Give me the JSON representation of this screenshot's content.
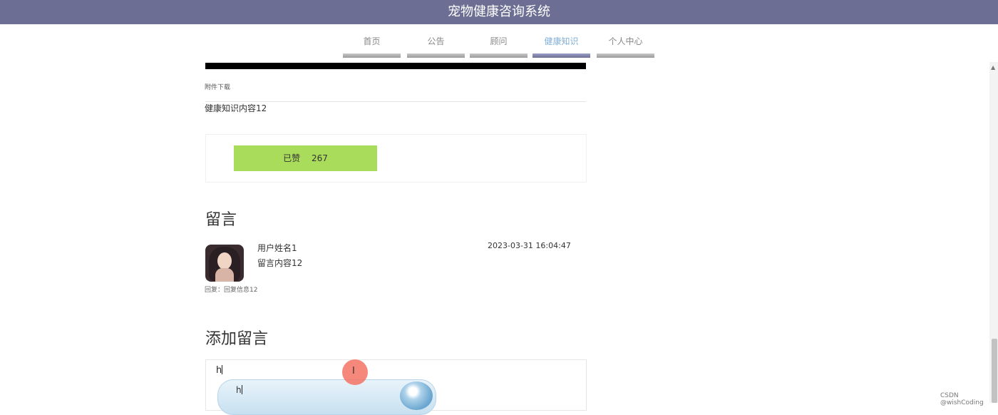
{
  "header": {
    "title": "宠物健康咨询系统"
  },
  "nav": {
    "items": [
      {
        "label": "首页"
      },
      {
        "label": "公告"
      },
      {
        "label": "顾问"
      },
      {
        "label": "健康知识"
      },
      {
        "label": "个人中心"
      }
    ],
    "active": "健康知识"
  },
  "article": {
    "attachment_label": "附件下载",
    "content": "健康知识内容12",
    "like": {
      "label": "已赞",
      "count": "267"
    }
  },
  "comments": {
    "heading": "留言",
    "items": [
      {
        "user": "用户姓名1",
        "content": "留言内容12",
        "time": "2023-03-31 16:04:47",
        "reply": "回复：回复信息12"
      }
    ]
  },
  "add_comment": {
    "heading": "添加留言",
    "value": "h",
    "ime_composition": "h"
  },
  "watermark": "CSDN @wishCoding",
  "colors": {
    "header_bg": "#6d6e93",
    "like_btn": "#a9dc5a",
    "nav_active_text": "#82b0d8"
  }
}
